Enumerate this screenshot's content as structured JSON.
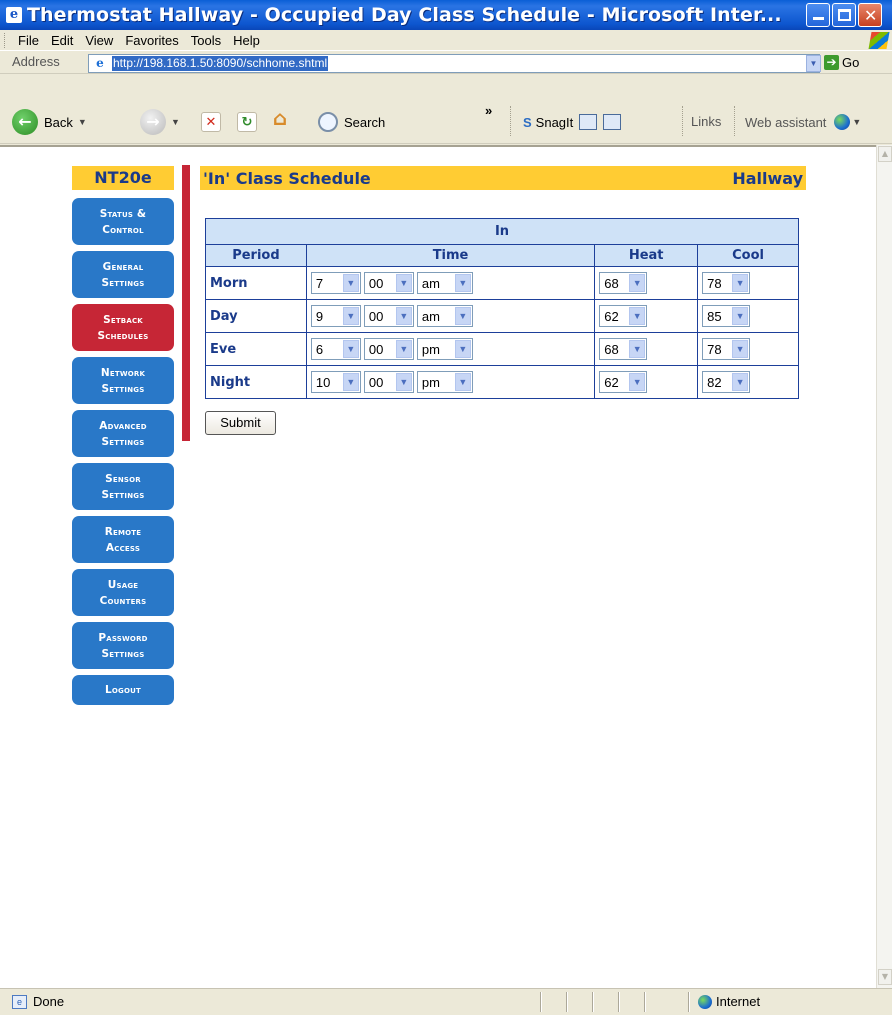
{
  "window": {
    "title": "Thermostat Hallway - Occupied Day Class Schedule - Microsoft Inter...",
    "app_icon": "ie-icon"
  },
  "menu": [
    "File",
    "Edit",
    "View",
    "Favorites",
    "Tools",
    "Help"
  ],
  "address": {
    "label": "Address",
    "url": "http://198.168.1.50:8090/schhome.shtml",
    "go_label": "Go"
  },
  "toolbar": {
    "back_label": "Back",
    "search_label": "Search",
    "snagit_label": "SnagIt",
    "links_label": "Links",
    "assistant_label": "Web assistant",
    "overflow": "»"
  },
  "sidebar": {
    "brand": "NT20e",
    "items": [
      {
        "line1": "Status &",
        "line2": "Control",
        "active": false
      },
      {
        "line1": "General",
        "line2": "Settings",
        "active": false
      },
      {
        "line1": "Setback",
        "line2": "Schedules",
        "active": true
      },
      {
        "line1": "Network",
        "line2": "Settings",
        "active": false
      },
      {
        "line1": "Advanced",
        "line2": "Settings",
        "active": false
      },
      {
        "line1": "Sensor",
        "line2": "Settings",
        "active": false
      },
      {
        "line1": "Remote",
        "line2": "Access",
        "active": false
      },
      {
        "line1": "Usage",
        "line2": "Counters",
        "active": false
      },
      {
        "line1": "Password",
        "line2": "Settings",
        "active": false
      },
      {
        "line1": "Logout",
        "line2": "",
        "active": false
      }
    ]
  },
  "content": {
    "title": "'In' Class Schedule",
    "location": "Hallway",
    "table_caption": "In",
    "columns": [
      "Period",
      "Time",
      "Heat",
      "Cool"
    ],
    "rows": [
      {
        "period": "Morn",
        "hour": "7",
        "minute": "00",
        "ampm": "am",
        "heat": "68",
        "cool": "78"
      },
      {
        "period": "Day",
        "hour": "9",
        "minute": "00",
        "ampm": "am",
        "heat": "62",
        "cool": "85"
      },
      {
        "period": "Eve",
        "hour": "6",
        "minute": "00",
        "ampm": "pm",
        "heat": "68",
        "cool": "78"
      },
      {
        "period": "Night",
        "hour": "10",
        "minute": "00",
        "ampm": "pm",
        "heat": "62",
        "cool": "82"
      }
    ],
    "submit_label": "Submit"
  },
  "status": {
    "text": "Done",
    "zone": "Internet"
  },
  "colors": {
    "nav_blue": "#2978c8",
    "nav_active": "#c62636",
    "header_yellow": "#ffcc33",
    "header_text": "#1a3a8a"
  }
}
